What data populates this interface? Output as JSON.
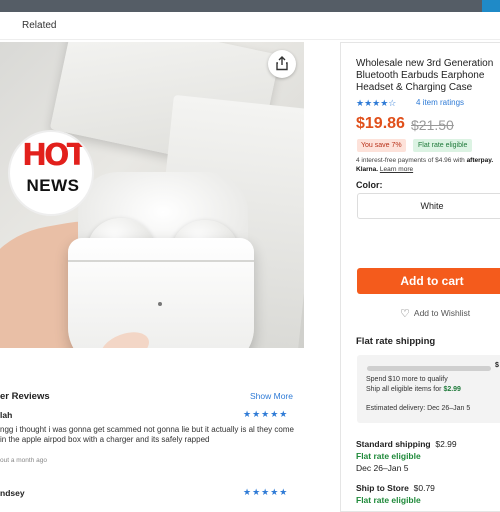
{
  "header": {
    "related_label": "Related"
  },
  "product": {
    "badge_line1": "HOT",
    "badge_line2": "NEWS",
    "title": "Wholesale new 3rd Generation Bluetooth Earbuds Earphone Headset & Charging Case",
    "stars": "★★★★☆",
    "ratings_link": "4 item ratings",
    "price": "$19.86",
    "old_price": "$21.50",
    "save_badge": "You save 7%",
    "flat_badge": "Flat rate eligible",
    "installment_text": "4 interest-free payments of $4.96 with ",
    "installment_brand": "afterpay.",
    "installment_klarna": "Klarna.",
    "learn_more": "Learn more",
    "color_label": "Color:",
    "color_option": "White",
    "add_to_cart": "Add to cart",
    "wishlist": "Add to Wishlist"
  },
  "shipping": {
    "heading": "Flat rate shipping",
    "progress_value": "$",
    "progress_fraction": 0.0,
    "line1": "Spend $10 more to qualify",
    "line2_prefix": "Ship all eligible items for ",
    "line2_price": "$2.99",
    "estimate": "Estimated delivery: Dec 26–Jan 5",
    "standard_label": "Standard shipping",
    "standard_price": "$2.99",
    "standard_flat": "Flat rate eligible",
    "standard_dates": "Dec 26–Jan 5",
    "store_label": "Ship to Store",
    "store_price": "$0.79",
    "store_flat": "Flat rate eligible"
  },
  "reviews": {
    "heading": "er Reviews",
    "show_more": "Show More",
    "items": [
      {
        "name": "lah",
        "stars": "★★★★★",
        "text": "ngg i thought i was gonna get scammed not gonna lie but it actually is al they come in the apple airpod box with a charger and its safely rapped",
        "time": "out a month ago"
      },
      {
        "name": "ndsey",
        "stars": "★★★★★"
      }
    ]
  },
  "colors": {
    "accent_blue": "#2f7bd6",
    "price_orange": "#e0501b",
    "cart_orange": "#f45b1c",
    "flat_green": "#1f8a3a"
  }
}
